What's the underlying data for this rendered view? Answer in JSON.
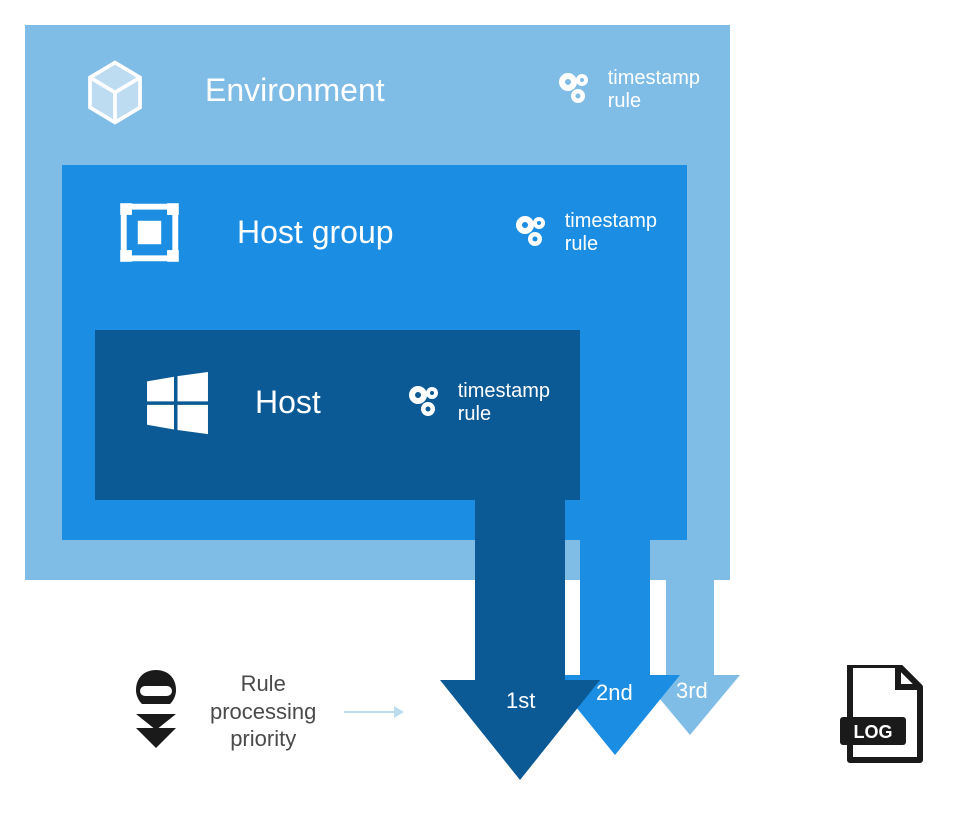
{
  "layers": {
    "environment": {
      "title": "Environment",
      "ts_label": "timestamp\nrule"
    },
    "host_group": {
      "title": "Host group",
      "ts_label": "timestamp\nrule"
    },
    "host": {
      "title": "Host",
      "ts_label": "timestamp\nrule"
    }
  },
  "arrows": {
    "first": "1st",
    "second": "2nd",
    "third": "3rd"
  },
  "rule_priority": "Rule\nprocessing\npriority",
  "colors": {
    "env_bg": "#7fbce6",
    "hg_bg": "#1b8de3",
    "host_bg": "#0b5a95"
  }
}
